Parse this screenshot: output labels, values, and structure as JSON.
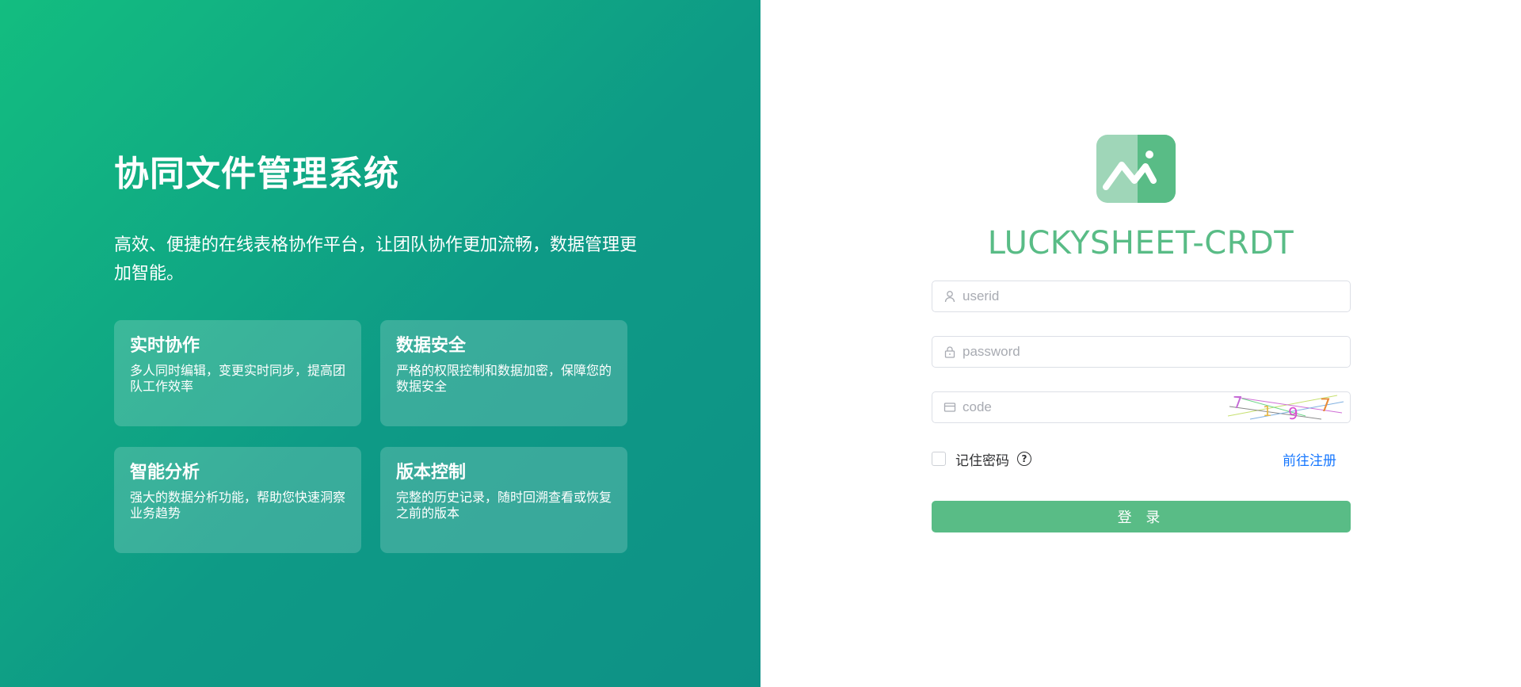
{
  "hero": {
    "title": "协同文件管理系统",
    "subtitle": "高效、便捷的在线表格协作平台，让团队协作更加流畅，数据管理更加智能。",
    "features": [
      {
        "title": "实时协作",
        "desc": "多人同时编辑，变更实时同步，提高团队工作效率"
      },
      {
        "title": "数据安全",
        "desc": "严格的权限控制和数据加密，保障您的数据安全"
      },
      {
        "title": "智能分析",
        "desc": "强大的数据分析功能，帮助您快速洞察业务趋势"
      },
      {
        "title": "版本控制",
        "desc": "完整的历史记录，随时回溯查看或恢复之前的版本"
      }
    ]
  },
  "login": {
    "app_name": "LUCKYSHEET-CRDT",
    "userid_placeholder": "userid",
    "password_placeholder": "password",
    "code_placeholder": "code",
    "captcha_text": "7197",
    "remember_label": "记住密码",
    "help_symbol": "?",
    "register_label": "前往注册",
    "login_label": "登 录"
  },
  "colors": {
    "gradient_start": "#13bd80",
    "gradient_end": "#0e9186",
    "brand_green": "#59bc86",
    "link_blue": "#1677ff"
  },
  "icons": {
    "userid": "user-icon",
    "password": "lock-icon",
    "code": "card-icon",
    "logo": "mountain-logo-icon"
  }
}
